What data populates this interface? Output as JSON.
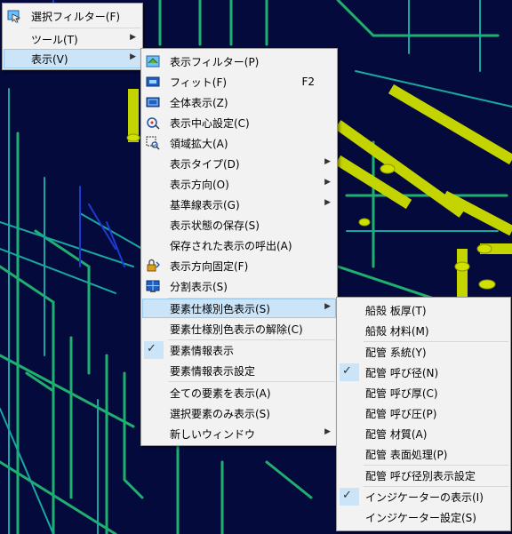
{
  "colors": {
    "background": "#050a3c",
    "menu_bg": "#f2f2f2",
    "highlight": "#cce4f7",
    "pipe_yellow": "#c8d800",
    "pipe_green": "#1fd06a",
    "pipe_cyan": "#1ab0a0",
    "pipe_blue": "#1a3cd0"
  },
  "menu1": {
    "items": [
      {
        "label": "選択フィルター(F)",
        "icon": "select-filter-icon"
      },
      {
        "label": "ツール(T)",
        "submenu": true
      },
      {
        "label": "表示(V)",
        "submenu": true,
        "highlighted": true
      }
    ]
  },
  "menu2": {
    "items": [
      {
        "label": "表示フィルター(P)",
        "icon": "display-filter-icon"
      },
      {
        "label": "フィット(F)",
        "shortcut": "F2",
        "icon": "fit-icon"
      },
      {
        "label": "全体表示(Z)",
        "icon": "show-all-icon"
      },
      {
        "label": "表示中心設定(C)",
        "icon": "center-set-icon"
      },
      {
        "label": "領域拡大(A)",
        "icon": "area-zoom-icon"
      },
      {
        "label": "表示タイプ(D)",
        "submenu": true
      },
      {
        "label": "表示方向(O)",
        "submenu": true
      },
      {
        "label": "基準線表示(G)",
        "submenu": true
      },
      {
        "label": "表示状態の保存(S)"
      },
      {
        "label": "保存された表示の呼出(A)"
      },
      {
        "label": "表示方向固定(F)",
        "icon": "lock-direction-icon"
      },
      {
        "label": "分割表示(S)",
        "icon": "split-view-icon"
      },
      {
        "label": "要素仕様別色表示(S)",
        "submenu": true,
        "highlighted": true
      },
      {
        "label": "要素仕様別色表示の解除(C)"
      },
      {
        "label": "要素情報表示",
        "checked": true
      },
      {
        "label": "要素情報表示設定"
      },
      {
        "label": "全ての要素を表示(A)"
      },
      {
        "label": "選択要素のみ表示(S)"
      },
      {
        "label": "新しいウィンドウ",
        "submenu": true
      }
    ]
  },
  "menu3": {
    "items": [
      {
        "label": "船殻 板厚(T)"
      },
      {
        "label": "船殻 材料(M)"
      },
      {
        "label": "配管 系統(Y)"
      },
      {
        "label": "配管 呼び径(N)",
        "checked": true
      },
      {
        "label": "配管 呼び厚(C)"
      },
      {
        "label": "配管 呼び圧(P)"
      },
      {
        "label": "配管 材質(A)"
      },
      {
        "label": "配管 表面処理(P)"
      },
      {
        "label": "配管 呼び径別表示設定"
      },
      {
        "label": "インジケーターの表示(I)",
        "checked": true
      },
      {
        "label": "インジケーター設定(S)"
      }
    ]
  }
}
